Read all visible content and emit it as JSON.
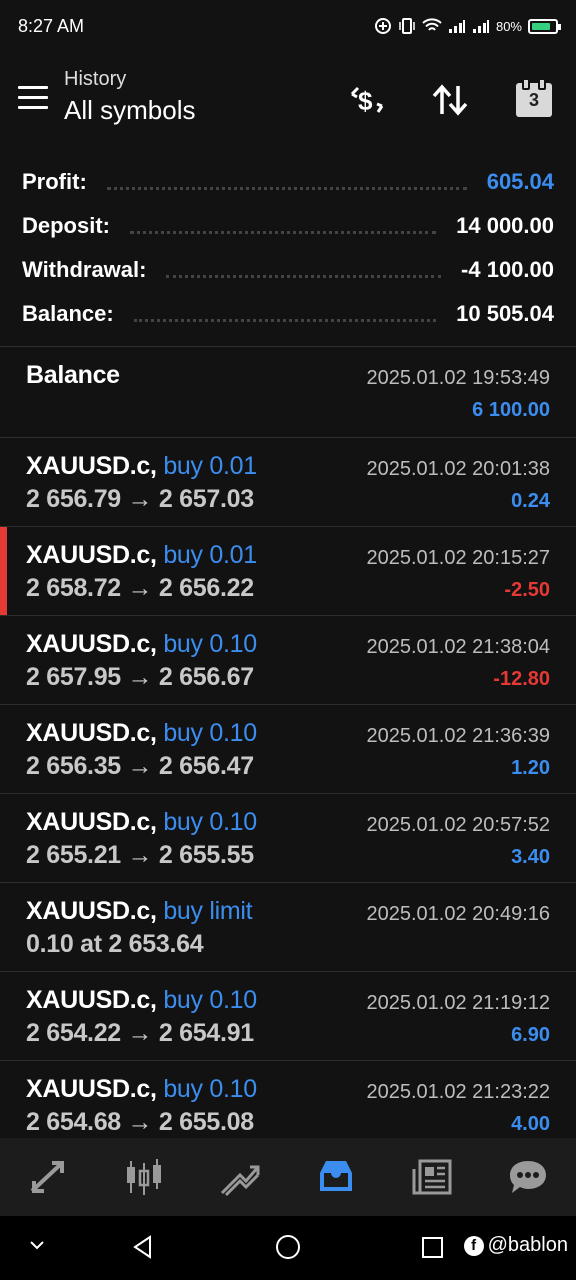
{
  "status": {
    "time": "8:27 AM",
    "battery": "80%"
  },
  "header": {
    "subtitle": "History",
    "title": "All symbols",
    "calendar_day": "3"
  },
  "summary": {
    "profit_label": "Profit:",
    "profit_value": "605.04",
    "deposit_label": "Deposit:",
    "deposit_value": "14 000.00",
    "withdrawal_label": "Withdrawal:",
    "withdrawal_value": "-4 100.00",
    "balance_label": "Balance:",
    "balance_value": "10 505.04"
  },
  "items": [
    {
      "title": "Balance",
      "op": "",
      "line2": "",
      "time": "2025.01.02 19:53:49",
      "pnl": "6 100.00"
    },
    {
      "title": "XAUUSD.c,",
      "op": "buy 0.01",
      "line2": "2 656.79 → 2 657.03",
      "time": "2025.01.02 20:01:38",
      "pnl": "0.24"
    },
    {
      "title": "XAUUSD.c,",
      "op": "buy 0.01",
      "line2": "2 658.72 → 2 656.22",
      "time": "2025.01.02 20:15:27",
      "pnl": "-2.50"
    },
    {
      "title": "XAUUSD.c,",
      "op": "buy 0.10",
      "line2": "2 657.95 → 2 656.67",
      "time": "2025.01.02 21:38:04",
      "pnl": "-12.80"
    },
    {
      "title": "XAUUSD.c,",
      "op": "buy 0.10",
      "line2": "2 656.35 → 2 656.47",
      "time": "2025.01.02 21:36:39",
      "pnl": "1.20"
    },
    {
      "title": "XAUUSD.c,",
      "op": "buy 0.10",
      "line2": "2 655.21 → 2 655.55",
      "time": "2025.01.02 20:57:52",
      "pnl": "3.40"
    },
    {
      "title": "XAUUSD.c,",
      "op": "buy limit",
      "line2": "0.10 at 2 653.64",
      "time": "2025.01.02 20:49:16",
      "pnl": ""
    },
    {
      "title": "XAUUSD.c,",
      "op": "buy 0.10",
      "line2": "2 654.22 → 2 654.91",
      "time": "2025.01.02 21:19:12",
      "pnl": "6.90"
    },
    {
      "title": "XAUUSD.c,",
      "op": "buy 0.10",
      "line2": "2 654.68 → 2 655.08",
      "time": "2025.01.02 21:23:22",
      "pnl": "4.00"
    }
  ],
  "watermark": "@bablon",
  "colors": {
    "positive": "#3b8ef0",
    "negative": "#e53935",
    "active_nav": "#3b8ef0"
  }
}
